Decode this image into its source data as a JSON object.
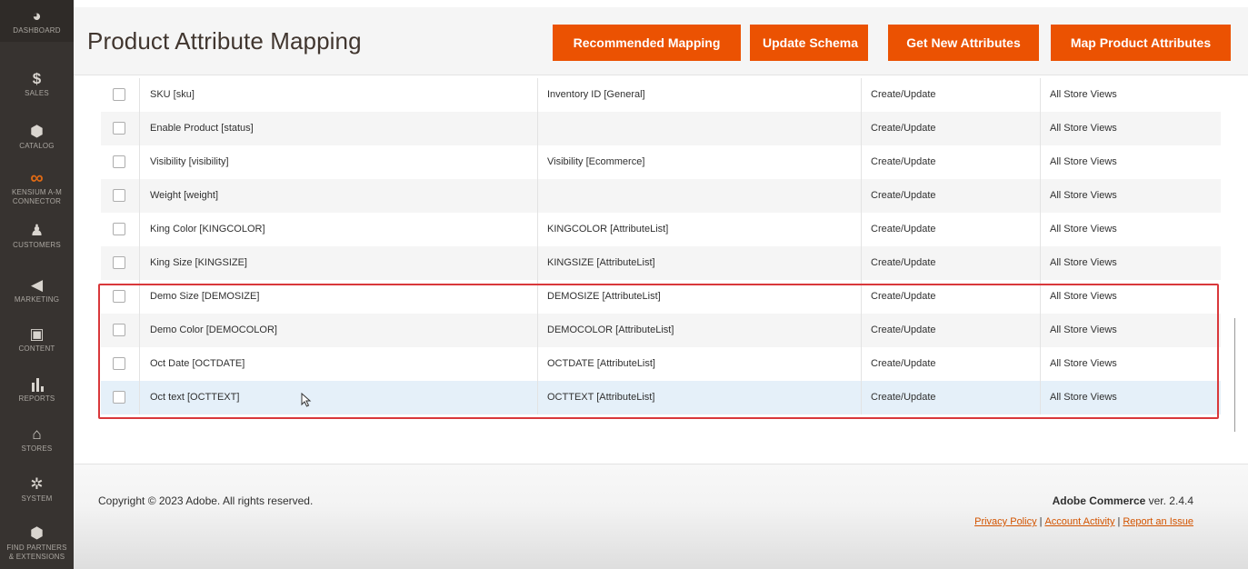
{
  "sidebar": {
    "items": [
      {
        "icon": "dashboard-icon",
        "glyph": "◕",
        "label": "DASHBOARD"
      },
      {
        "icon": "dollar-icon",
        "glyph": "$",
        "label": "SALES"
      },
      {
        "icon": "cube-icon",
        "glyph": "⬢",
        "label": "CATALOG"
      },
      {
        "icon": "infinity-icon",
        "glyph": "∞",
        "label_1": "KENSIUM A-M",
        "label_2": "CONNECTOR"
      },
      {
        "icon": "person-icon",
        "glyph": "♟",
        "label": "CUSTOMERS"
      },
      {
        "icon": "megaphone-icon",
        "glyph": "◀",
        "label": "MARKETING"
      },
      {
        "icon": "content-icon",
        "glyph": "▣",
        "label": "CONTENT"
      },
      {
        "icon": "bar-chart-icon",
        "glyph": "▮",
        "label": "REPORTS"
      },
      {
        "icon": "store-icon",
        "glyph": "⌂",
        "label": "STORES"
      },
      {
        "icon": "gear-icon",
        "glyph": "✲",
        "label": "SYSTEM"
      },
      {
        "icon": "box-icon",
        "glyph": "⬢",
        "label_1": "FIND PARTNERS",
        "label_2": "& EXTENSIONS"
      }
    ]
  },
  "header": {
    "title": "Product Attribute Mapping",
    "buttons": {
      "recommended": "Recommended Mapping",
      "update_schema": "Update Schema",
      "get_new": "Get New Attributes",
      "map_product": "Map Product Attributes"
    }
  },
  "rows": [
    {
      "attr": "SKU [sku]",
      "map": "Inventory ID [General]",
      "action": "Create/Update",
      "store": "All Store Views"
    },
    {
      "attr": "Enable Product [status]",
      "map": "",
      "action": "Create/Update",
      "store": "All Store Views"
    },
    {
      "attr": "Visibility [visibility]",
      "map": "Visibility [Ecommerce]",
      "action": "Create/Update",
      "store": "All Store Views"
    },
    {
      "attr": "Weight [weight]",
      "map": "",
      "action": "Create/Update",
      "store": "All Store Views"
    },
    {
      "attr": "King Color [KINGCOLOR]",
      "map": "KINGCOLOR [AttributeList]",
      "action": "Create/Update",
      "store": "All Store Views"
    },
    {
      "attr": "King Size [KINGSIZE]",
      "map": "KINGSIZE [AttributeList]",
      "action": "Create/Update",
      "store": "All Store Views"
    },
    {
      "attr": "Demo Size [DEMOSIZE]",
      "map": "DEMOSIZE [AttributeList]",
      "action": "Create/Update",
      "store": "All Store Views"
    },
    {
      "attr": "Demo Color [DEMOCOLOR]",
      "map": "DEMOCOLOR [AttributeList]",
      "action": "Create/Update",
      "store": "All Store Views"
    },
    {
      "attr": "Oct Date [OCTDATE]",
      "map": "OCTDATE [AttributeList]",
      "action": "Create/Update",
      "store": "All Store Views"
    },
    {
      "attr": "Oct text [OCTTEXT]",
      "map": "OCTTEXT [AttributeList]",
      "action": "Create/Update",
      "store": "All Store Views"
    }
  ],
  "footer": {
    "copyright": "Copyright © 2023 Adobe. All rights reserved.",
    "brand_name": "Adobe Commerce",
    "brand_version": " ver. 2.4.4",
    "links": {
      "privacy": "Privacy Policy",
      "activity": "Account Activity",
      "report": "Report an Issue",
      "separator": "|"
    }
  },
  "colors": {
    "accent": "#eb5202",
    "sidebar_bg": "#373330",
    "highlight": "#d9383b",
    "link": "#d35400"
  }
}
